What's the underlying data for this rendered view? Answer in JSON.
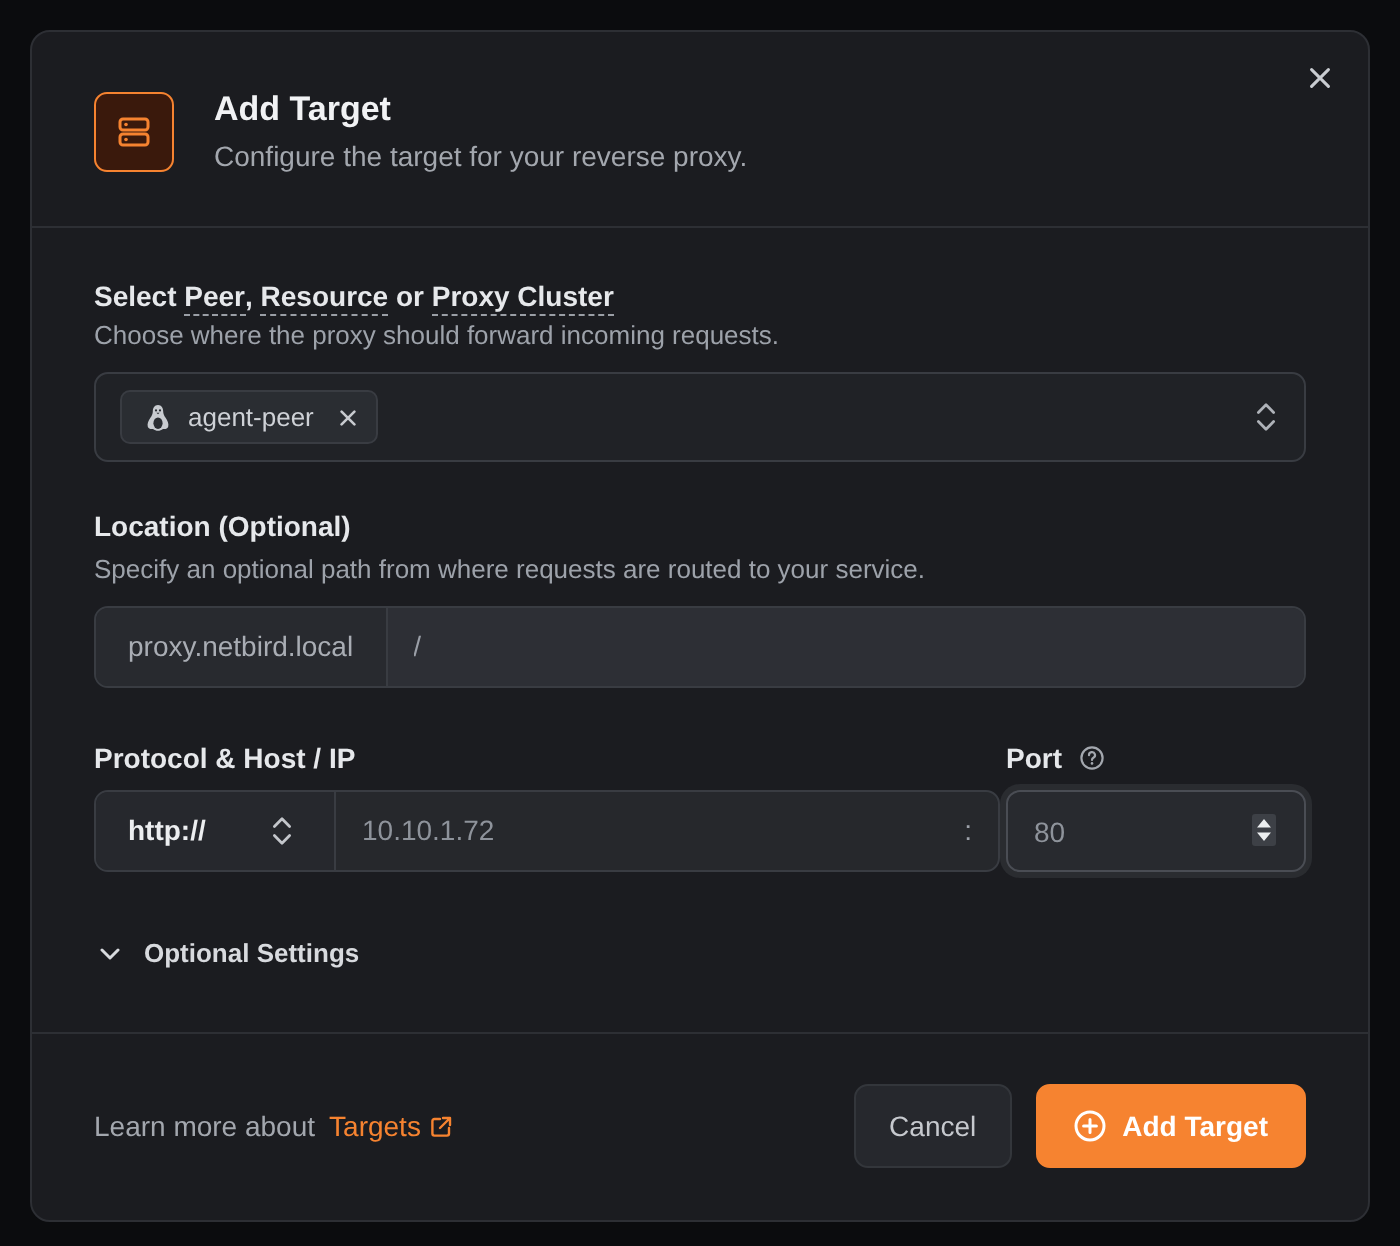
{
  "dialog": {
    "title": "Add Target",
    "subtitle": "Configure the target for your reverse proxy."
  },
  "destination": {
    "label": [
      {
        "text": "Select ",
        "tooltip": false
      },
      {
        "text": "Peer",
        "tooltip": true
      },
      {
        "text": ", ",
        "tooltip": false
      },
      {
        "text": "Resource",
        "tooltip": true
      },
      {
        "text": " or ",
        "tooltip": false
      },
      {
        "text": "Proxy Cluster",
        "tooltip": true
      }
    ],
    "description": "Choose where the proxy should forward incoming requests.",
    "chips": [
      {
        "label": "agent-peer"
      }
    ]
  },
  "location": {
    "label": "Location (Optional)",
    "description": "Specify an optional path from where requests are routed to your service.",
    "prefix": "proxy.netbird.local",
    "value": "/"
  },
  "address": {
    "label": "Protocol & Host / IP",
    "protocol": "http://",
    "host": "10.10.1.72",
    "separator": ":"
  },
  "port": {
    "label": "Port",
    "value": "80",
    "focused": true
  },
  "optional_settings": {
    "label": "Optional Settings",
    "expanded": false
  },
  "footer": {
    "text": "Learn more about",
    "link": "Targets"
  },
  "buttons": [
    {
      "label": "Cancel",
      "kind": "secondary"
    },
    {
      "label": "Add Target",
      "kind": "primary"
    }
  ]
}
